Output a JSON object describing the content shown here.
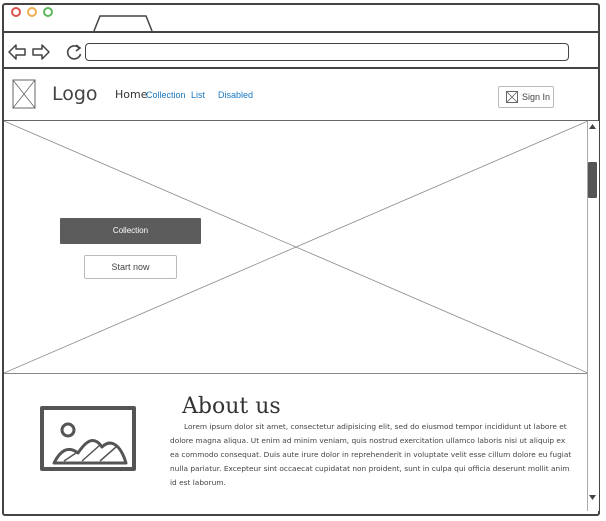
{
  "browser": {
    "window_controls": {
      "close_color": "#d9534f",
      "minimize_color": "#f0ad4e",
      "maximize_color": "#5cb85c"
    },
    "url": ""
  },
  "nav": {
    "logo": "Logo",
    "links": [
      {
        "label": "Home",
        "state": "active"
      },
      {
        "label": "Collection",
        "state": "link"
      },
      {
        "label": "List",
        "state": "link"
      },
      {
        "label": "Disabled",
        "state": "link"
      }
    ],
    "signin_label": "Sign In",
    "link_color": "#1a78c2"
  },
  "hero": {
    "primary_button": "Collection",
    "secondary_button": "Start now"
  },
  "about": {
    "title": "About us",
    "body": "Lorem ipsum dolor sit amet, consectetur adipisicing elit, sed do eiusmod tempor incididunt ut labore et dolore magna aliqua. Ut enim ad minim veniam, quis nostrud exercitation ullamco laboris nisi ut aliquip ex ea commodo consequat. Duis aute irure dolor in reprehenderit in voluptate velit esse cillum dolore eu fugiat nulla pariatur. Excepteur sint occaecat cupidatat non proident, sunt in culpa qui officia deserunt mollit anim id est laborum."
  }
}
